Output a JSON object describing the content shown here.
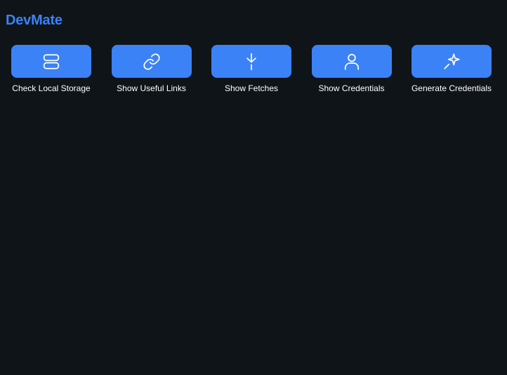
{
  "app": {
    "title": "DevMate",
    "accent_color": "#3b82f6",
    "background_color": "#0f1418"
  },
  "tools": [
    {
      "label": "Check Local Storage",
      "icon": "storage-icon"
    },
    {
      "label": "Show Useful Links",
      "icon": "link-icon"
    },
    {
      "label": "Show Fetches",
      "icon": "fetch-arrow-icon"
    },
    {
      "label": "Show Credentials",
      "icon": "user-icon"
    },
    {
      "label": "Generate Credentials",
      "icon": "magic-wand-icon"
    }
  ]
}
